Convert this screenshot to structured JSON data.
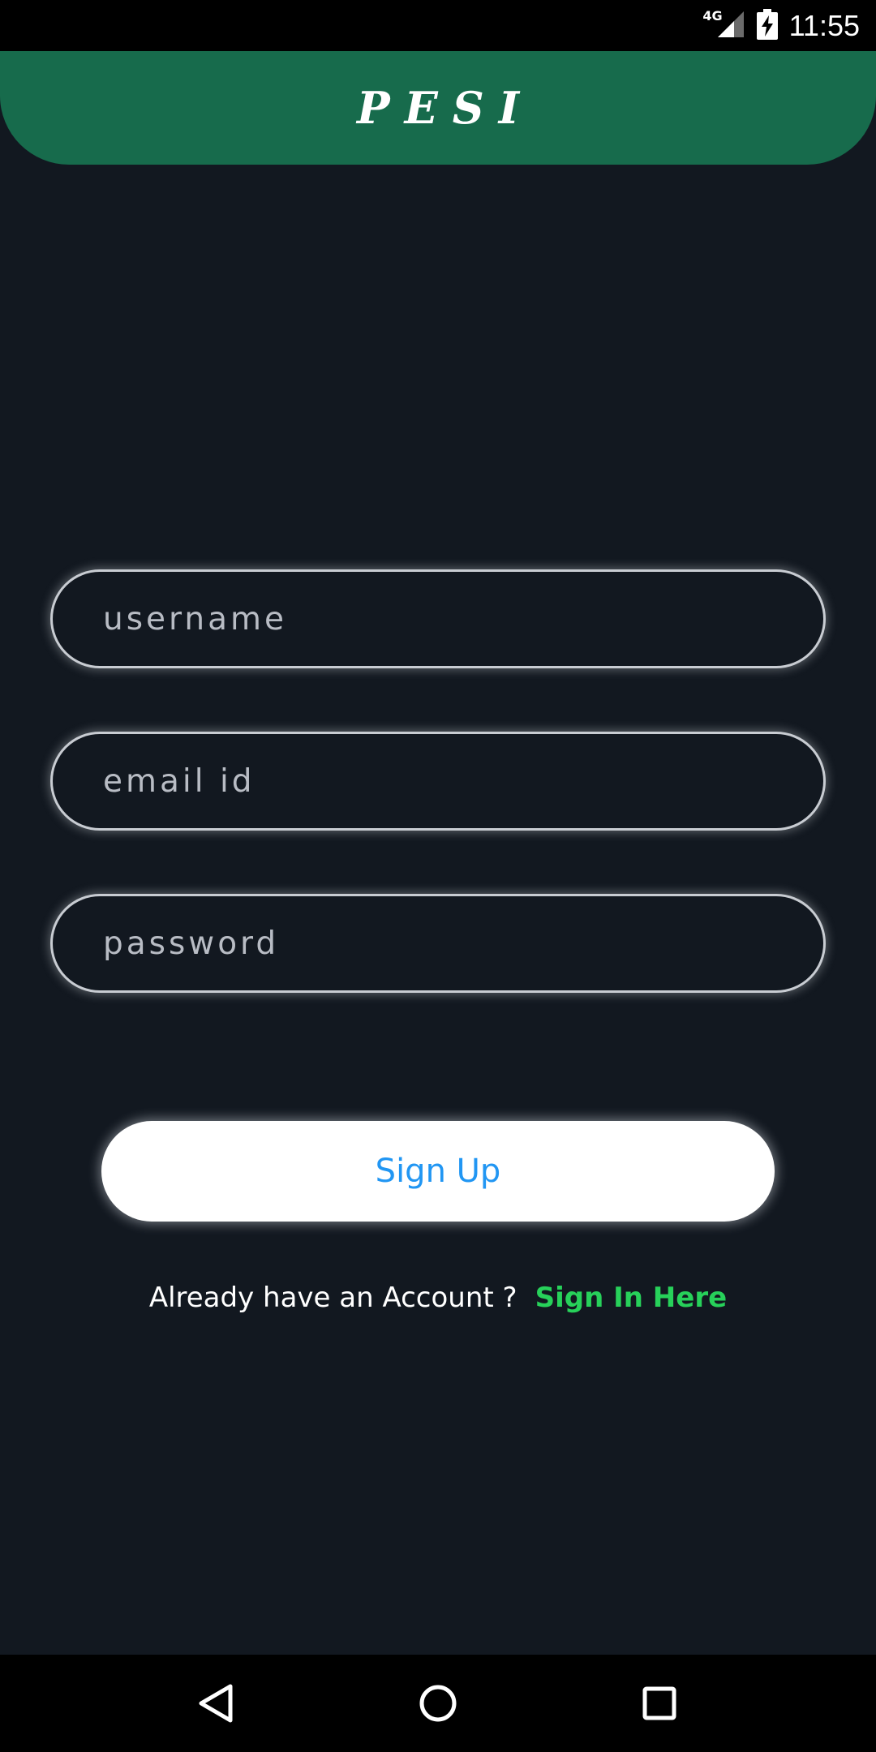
{
  "status_bar": {
    "network": "4G",
    "time": "11:55"
  },
  "header": {
    "title": "PESI",
    "color": "#176b4c"
  },
  "form": {
    "username_placeholder": "username",
    "email_placeholder": "email id",
    "password_placeholder": "password"
  },
  "signup_button": {
    "label": "Sign Up"
  },
  "signin": {
    "prompt": "Already have an Account ?",
    "link": "Sign In Here",
    "link_color": "#27d15a"
  },
  "nav": {
    "icons": [
      "back-icon",
      "home-icon",
      "recents-icon"
    ]
  }
}
